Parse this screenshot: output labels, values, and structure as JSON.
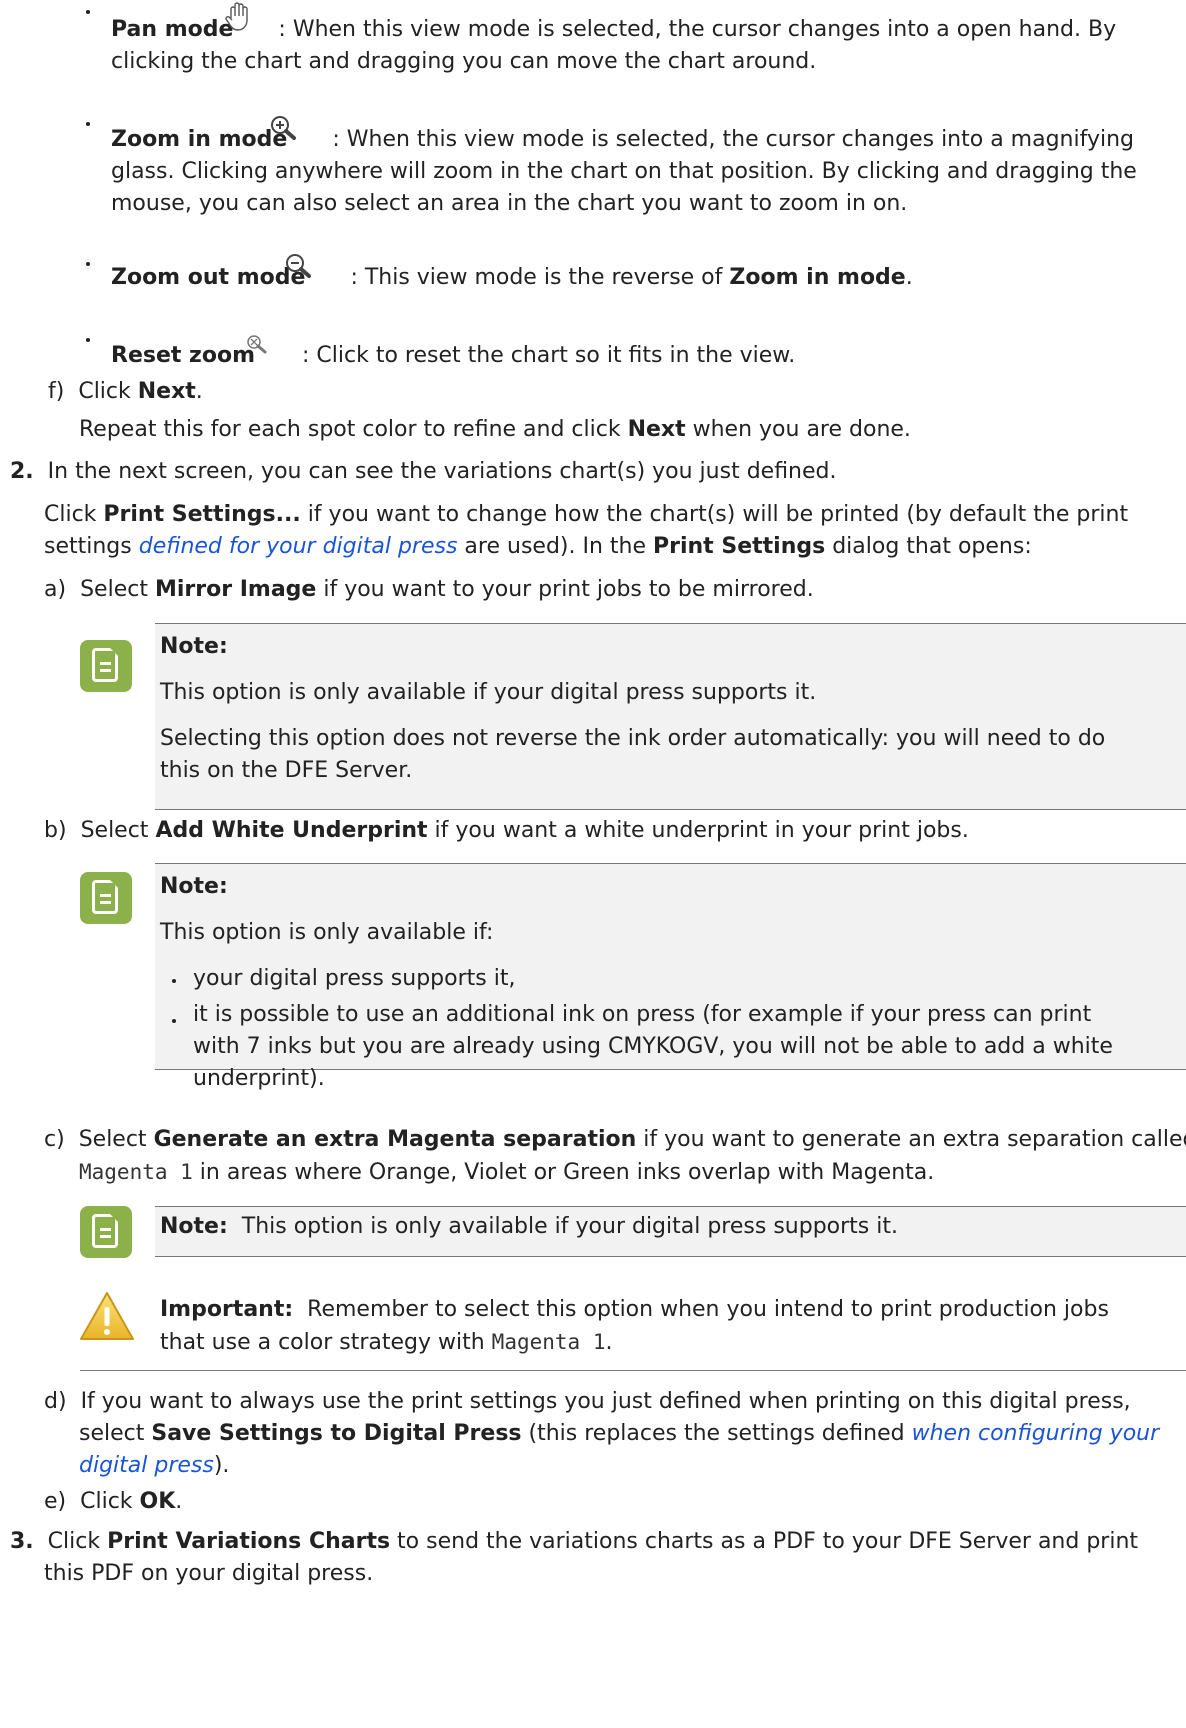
{
  "view_modes": [
    {
      "name": "Pan mode",
      "icon": "open-hand-icon",
      "text": ": When this view mode is selected, the cursor changes into a open hand. By",
      "text2": "clicking the chart and dragging you can move the chart around."
    },
    {
      "name": "Zoom in mode",
      "icon": "zoom-in-icon",
      "text": ": When this view mode is selected, the cursor changes into a magnifying",
      "text2": "glass. Clicking anywhere will zoom in the chart on that position. By clicking and dragging the",
      "text3": "mouse, you can also select an area in the chart you want to zoom in on."
    },
    {
      "name": "Zoom out mode",
      "icon": "zoom-out-icon",
      "text": ": This view mode is the reverse of ",
      "ref": "Zoom in mode",
      "end": "."
    },
    {
      "name": "Reset zoom",
      "icon": "reset-zoom-icon",
      "text": ": Click to reset the chart so it fits in the view."
    }
  ],
  "step_f": {
    "label": "f)",
    "pre": "Click ",
    "bold": "Next",
    "end": ".",
    "repeat_pre": "Repeat this for each spot color to refine and click ",
    "repeat_bold": "Next",
    "repeat_end": " when you are done."
  },
  "step2": {
    "num": "2.",
    "text": "In the next screen, you can see the variations chart(s) you just defined.",
    "p1_pre": "Click ",
    "p1_bold": "Print Settings...",
    "p1_mid": " if you want to change how the chart(s) will be printed (by default the print",
    "p2_pre": "settings ",
    "p2_link": "defined for your digital press",
    "p2_mid": " are used). In the ",
    "p2_bold": "Print Settings",
    "p2_end": " dialog that opens:",
    "a": {
      "label": "a)",
      "pre": "Select ",
      "bold": "Mirror Image",
      "end": " if you want to your print jobs to be mirrored."
    },
    "note_a": {
      "title": "Note:",
      "p1": "This option is only available if your digital press supports it.",
      "p2a": "Selecting this option does not reverse the ink order automatically: you will need to do",
      "p2b": "this on the DFE Server."
    },
    "b": {
      "label": "b)",
      "pre": "Select ",
      "bold": "Add White Underprint",
      "end": " if you want a white underprint in your print jobs."
    },
    "note_b": {
      "title": "Note:",
      "intro": "This option is only available if:",
      "li1": "your digital press supports it,",
      "li2a": "it is possible to use an additional ink on press (for example if your press can print",
      "li2b": "with 7 inks but you are already using CMYKOGV, you will not be able to add a white",
      "li2c": "underprint)."
    },
    "c": {
      "label": "c)",
      "pre": "Select ",
      "bold": "Generate an extra Magenta separation",
      "end": " if you want to generate an extra separation called",
      "code": "Magenta 1",
      "end2": " in areas where Orange, Violet or Green inks overlap with Magenta."
    },
    "note_c": {
      "title": "Note:",
      "text": "This option is only available if your digital press supports it."
    },
    "important": {
      "title": "Important:",
      "text": "Remember to select this option when you intend to print production jobs",
      "text2": "that use a color strategy with ",
      "code": "Magenta 1",
      "end": "."
    },
    "d": {
      "label": "d)",
      "text": "If you want to always use the print settings you just defined when printing on this digital press,",
      "pre2": "select ",
      "bold2": "Save Settings to Digital Press",
      "mid2": " (this replaces the settings defined ",
      "link2": "when configuring your",
      "link3": "digital press",
      "end3": ")."
    },
    "e": {
      "label": "e)",
      "pre": "Click ",
      "bold": "OK",
      "end": "."
    }
  },
  "step3": {
    "num": "3.",
    "pre": "Click ",
    "bold": "Print Variations Charts",
    "text": " to send the variations charts as a PDF to your DFE Server and print",
    "text2": "this PDF on your digital press."
  },
  "colors": {
    "note_icon": "#8cb04a",
    "link": "#1a55d6",
    "warning": "#f1c232"
  }
}
